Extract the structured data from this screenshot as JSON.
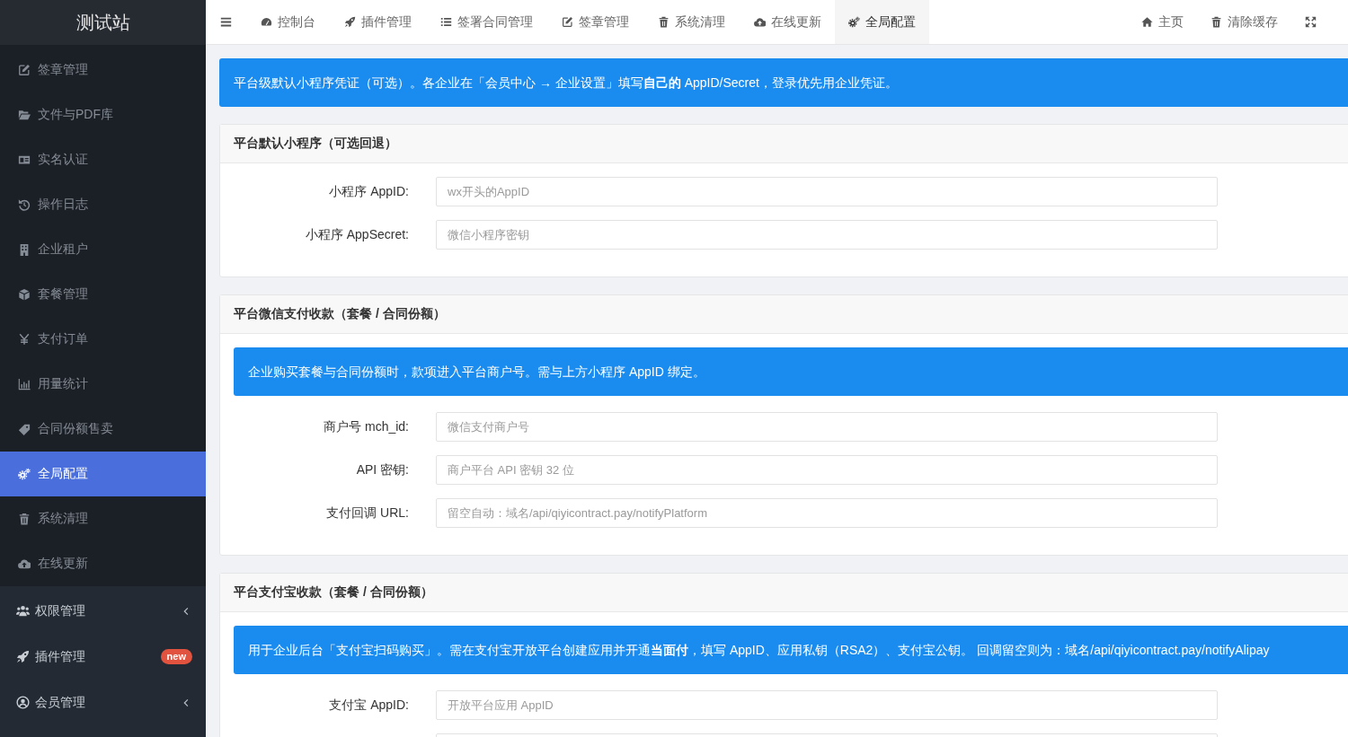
{
  "sidebar": {
    "title": "测试站",
    "items": [
      {
        "label": "签章管理",
        "selected": false
      },
      {
        "label": "文件与PDF库",
        "selected": false
      },
      {
        "label": "实名认证",
        "selected": false
      },
      {
        "label": "操作日志",
        "selected": false
      },
      {
        "label": "企业租户",
        "selected": false
      },
      {
        "label": "套餐管理",
        "selected": false
      },
      {
        "label": "支付订单",
        "selected": false
      },
      {
        "label": "用量统计",
        "selected": false
      },
      {
        "label": "合同份额售卖",
        "selected": false
      },
      {
        "label": "全局配置",
        "selected": true
      },
      {
        "label": "系统清理",
        "selected": false
      },
      {
        "label": "在线更新",
        "selected": false
      }
    ],
    "groups": [
      {
        "label": "权限管理",
        "kind": "submenu",
        "selected": false,
        "expanded": false
      },
      {
        "label": "插件管理",
        "kind": "link",
        "selected": false,
        "badge": "new"
      },
      {
        "label": "会员管理",
        "kind": "submenu",
        "selected": false,
        "expanded": false
      }
    ]
  },
  "topbar": {
    "tabs": [
      {
        "label": "控制台",
        "selected": false
      },
      {
        "label": "插件管理",
        "selected": false
      },
      {
        "label": "签署合同管理",
        "selected": false
      },
      {
        "label": "签章管理",
        "selected": false
      },
      {
        "label": "系统清理",
        "selected": false
      },
      {
        "label": "在线更新",
        "selected": false
      },
      {
        "label": "全局配置",
        "selected": true
      }
    ],
    "actions": [
      {
        "label": "主页"
      },
      {
        "label": "清除缓存"
      }
    ]
  },
  "notice": "平台级默认小程序凭证（可选）。各企业在「会员中心 → 企业设置」填写**自己的** AppID/Secret，登录优先用企业凭证。",
  "panels": [
    {
      "title": "平台默认小程序（可选回退）",
      "fields": [
        {
          "kind": "text",
          "label": "小程序 AppID:",
          "placeholder": "wx开头的AppID"
        },
        {
          "kind": "text",
          "label": "小程序 AppSecret:",
          "placeholder": "微信小程序密钥"
        }
      ]
    },
    {
      "title": "平台微信支付收款（套餐 / 合同份额）",
      "alert": "企业购买套餐与合同份额时，款项进入平台商户号。需与上方小程序 AppID 绑定。",
      "fields": [
        {
          "kind": "text",
          "label": "商户号 mch_id:",
          "placeholder": "微信支付商户号"
        },
        {
          "kind": "text",
          "label": "API 密钥:",
          "placeholder": "商户平台 API 密钥 32 位"
        },
        {
          "kind": "text",
          "label": "支付回调 URL:",
          "placeholder": "留空自动：域名/api/qiyicontract.pay/notifyPlatform"
        }
      ]
    },
    {
      "title": "平台支付宝收款（套餐 / 合同份额）",
      "alert": "用于企业后台「支付宝扫码购买」。需在支付宝开放平台创建应用并开通**当面付**，填写 AppID、应用私钥（RSA2）、支付宝公钥。 回调留空则为：域名/api/qiyicontract.pay/notifyAlipay",
      "fields": [
        {
          "kind": "text",
          "label": "支付宝 AppID:",
          "placeholder": "开放平台应用 AppID"
        },
        {
          "kind": "text"
        }
      ]
    }
  ]
}
